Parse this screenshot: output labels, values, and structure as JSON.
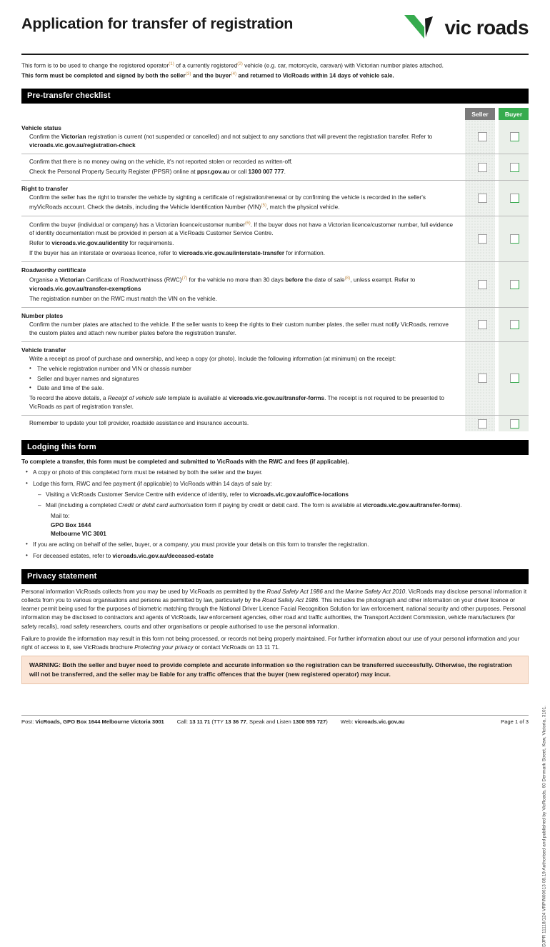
{
  "document": {
    "title": "Application for transfer of registration",
    "brand": {
      "name": "vic roads",
      "green": "#36ab4e",
      "dark": "#1a1a1a"
    }
  },
  "intro": {
    "line1_a": "This form is to be used to change the registered operator",
    "line1_fn1": "(1)",
    "line1_b": " of a currently registered",
    "line1_fn2": "(2)",
    "line1_c": " vehicle (e.g. car, motorcycle, caravan) with Victorian number plates attached.",
    "line2_a": "This form must be completed and signed by both the seller",
    "line2_fn3": "(3)",
    "line2_b": " and the buyer",
    "line2_fn4": "(4)",
    "line2_c": " and returned to VicRoads within 14 days of vehicle sale."
  },
  "checklist": {
    "section_title": "Pre-transfer checklist",
    "columns": {
      "seller": "Seller",
      "buyer": "Buyer"
    },
    "groups": [
      {
        "heading": "Vehicle status",
        "rows": [
          {
            "lines": [
              "Confirm the Victorian registration is current (not suspended or cancelled) and not subject to any sanctions that will prevent the registration transfer. Refer to vicroads.vic.gov.au/registration-check"
            ]
          },
          {
            "lines": [
              "Confirm that there is no money owing on the vehicle, it's not reported stolen or recorded as written-off.",
              "Check the Personal Property Security Register (PPSR) online at ppsr.gov.au or call 1300 007 777."
            ]
          }
        ]
      },
      {
        "heading": "Right to transfer",
        "rows": [
          {
            "lines": [
              "Confirm the seller has the right to transfer the vehicle by sighting a certificate of registration/renewal or by confirming the vehicle is recorded in the seller's myVicRoads account. Check the details, including the Vehicle Identification Number (VIN)(5), match the physical vehicle."
            ]
          },
          {
            "lines": [
              "Confirm the buyer (individual or company) has a Victorian licence/customer number(6). If the buyer does not have a Victorian licence/customer number, full evidence of identity documentation must be provided in person at a VicRoads Customer Service Centre.",
              "Refer to vicroads.vic.gov.au/identity for requirements.",
              "If the buyer has an interstate or overseas licence, refer to vicroads.vic.gov.au/interstate-transfer for information."
            ]
          }
        ]
      },
      {
        "heading": "Roadworthy certificate",
        "rows": [
          {
            "lines": [
              "Organise a Victorian Certificate of Roadworthiness (RWC)(7) for the vehicle no more than 30 days before the date of sale(8), unless exempt. Refer to vicroads.vic.gov.au/transfer-exemptions",
              "The registration number on the RWC must match the VIN on the vehicle."
            ]
          }
        ]
      },
      {
        "heading": "Number plates",
        "rows": [
          {
            "lines": [
              "Confirm the number plates are attached to the vehicle. If the seller wants to keep the rights to their custom number plates, the seller must notify VicRoads, remove the custom plates and attach new number plates before the registration transfer."
            ]
          }
        ]
      },
      {
        "heading": "Vehicle transfer",
        "rows": [
          {
            "lines": [
              "Write a receipt as proof of purchase and ownership, and keep a copy (or photo). Include the following information (at minimum) on the receipt:"
            ],
            "bullets": [
              "The vehicle registration number and VIN or chassis number",
              "Seller and buyer names and signatures",
              "Date and time of the sale."
            ],
            "after": "To record the above details, a Receipt of vehicle sale template is available at vicroads.vic.gov.au/transfer-forms. The receipt is not required to be presented to VicRoads as part of registration transfer."
          },
          {
            "lines": [
              "Remember to update your toll provider, roadside assistance and insurance accounts."
            ]
          }
        ]
      }
    ]
  },
  "lodging": {
    "section_title": "Lodging this form",
    "lead": "To complete a transfer, this form must be completed and submitted to VicRoads with the RWC and fees (if applicable).",
    "bullet1": "A copy or photo of this completed form must be retained by both the seller and the buyer.",
    "bullet2": "Lodge this form, RWC and fee payment (if applicable) to VicRoads within 14 days of sale by:",
    "sub1": "Visiting a VicRoads Customer Service Centre with evidence of identity, refer to vicroads.vic.gov.au/office-locations",
    "sub2": "Mail (including a completed Credit or debit card authorisation form if paying by credit or debit card. The form is available at vicroads.vic.gov.au/transfer-forms).",
    "mail_label": "Mail to:",
    "mail_line1": "GPO Box 1644",
    "mail_line2": "Melbourne VIC 3001",
    "bullet3": "If you are acting on behalf of the seller, buyer, or a company, you must provide your details on this form to transfer the registration.",
    "bullet4": "For deceased estates, refer to vicroads.vic.gov.au/deceased-estate"
  },
  "privacy": {
    "section_title": "Privacy statement",
    "para1": "Personal information VicRoads collects from you may be used by VicRoads as permitted by the Road Safety Act 1986 and the Marine Safety Act 2010. VicRoads may disclose personal information it collects from you to various organisations and persons as permitted by law, particularly by the Road Safety Act 1986. This includes the photograph and other information on your driver licence or learner permit being used for the purposes of biometric matching through the National Driver Licence Facial Recognition Solution for law enforcement, national security and other purposes. Personal information may be disclosed to contractors and agents of VicRoads, law enforcement agencies, other road and traffic authorities, the Transport Accident Commission, vehicle manufacturers (for safety recalls), road safety researchers, courts and other organisations or people authorised to use the personal information.",
    "para2": "Failure to provide the information may result in this form not being processed, or records not being properly maintained. For further information about our use of your personal information and your right of access to it, see VicRoads brochure Protecting your privacy or contact VicRoads on 13 11 71."
  },
  "warning": {
    "text": "WARNING: Both the seller and buyer need to provide complete and accurate information so the registration can be transferred successfully. Otherwise, the registration will not be transferred, and the seller may be liable for any traffic offences that the buyer (new registered operator) may incur.",
    "background": "#fbe5d6"
  },
  "footer": {
    "post": "Post: VicRoads, GPO Box 1644 Melbourne Victoria 3001",
    "call": "Call: 13 11 71 (TTY 13 36 77, Speak and Listen 1300 555 727)",
    "web": "Web: vicroads.vic.gov.au",
    "page": "Page 1 of 3"
  },
  "sidetext": "DJPR 11118/124  VRPIN00613 08.19 Authorised and published by VicRoads, 60 Denmark Street, Kew, Victoria, 3101."
}
